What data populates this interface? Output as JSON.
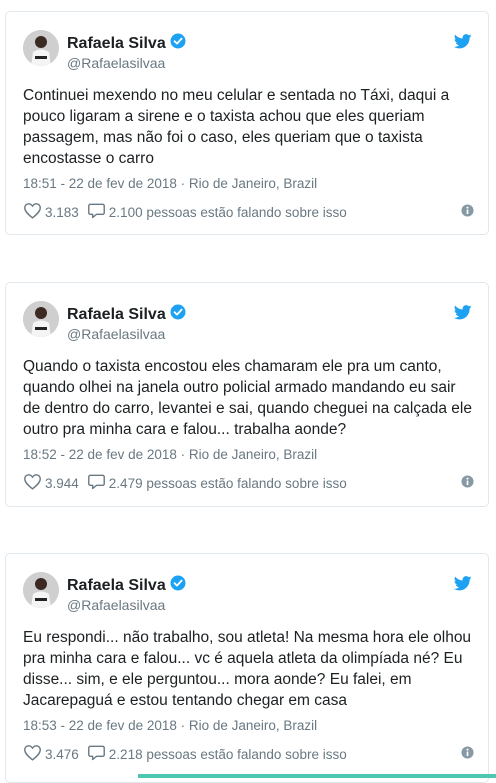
{
  "colors": {
    "twitter_blue": "#1da1f2",
    "muted": "#697882",
    "verified": "#1da1f2",
    "text": "#1c2022"
  },
  "tweets": [
    {
      "name": "Rafaela Silva",
      "handle": "@Rafaelasilvaa",
      "text": "Continuei mexendo no meu celular e sentada no Táxi, daqui a pouco ligaram a sirene e o taxista achou que eles queriam passagem, mas não foi o caso, eles queriam que o taxista encostasse o carro",
      "meta": "18:51 - 22 de fev de 2018 · Rio de Janeiro, Brazil",
      "likes": "3.183",
      "replies": "2.100 pessoas estão falando sobre isso"
    },
    {
      "name": "Rafaela Silva",
      "handle": "@Rafaelasilvaa",
      "text": "Quando o taxista encostou eles chamaram ele pra um canto, quando olhei na janela outro policial armado mandando eu sair de dentro do carro, levantei e sai, quando cheguei na calçada ele outro pra minha cara e falou... trabalha aonde?",
      "meta": "18:52 - 22 de fev de 2018 · Rio de Janeiro, Brazil",
      "likes": "3.944",
      "replies": "2.479 pessoas estão falando sobre isso"
    },
    {
      "name": "Rafaela Silva",
      "handle": "@Rafaelasilvaa",
      "text": "Eu respondi... não trabalho, sou atleta! Na mesma hora ele olhou pra minha cara e falou... vc é aquela atleta da olimpíada né? Eu disse... sim, e ele perguntou... mora aonde? Eu falei, em Jacarepaguá e estou tentando chegar em casa",
      "meta": "18:53 - 22 de fev de 2018 · Rio de Janeiro, Brazil",
      "likes": "3.476",
      "replies": "2.218 pessoas estão falando sobre isso"
    }
  ]
}
